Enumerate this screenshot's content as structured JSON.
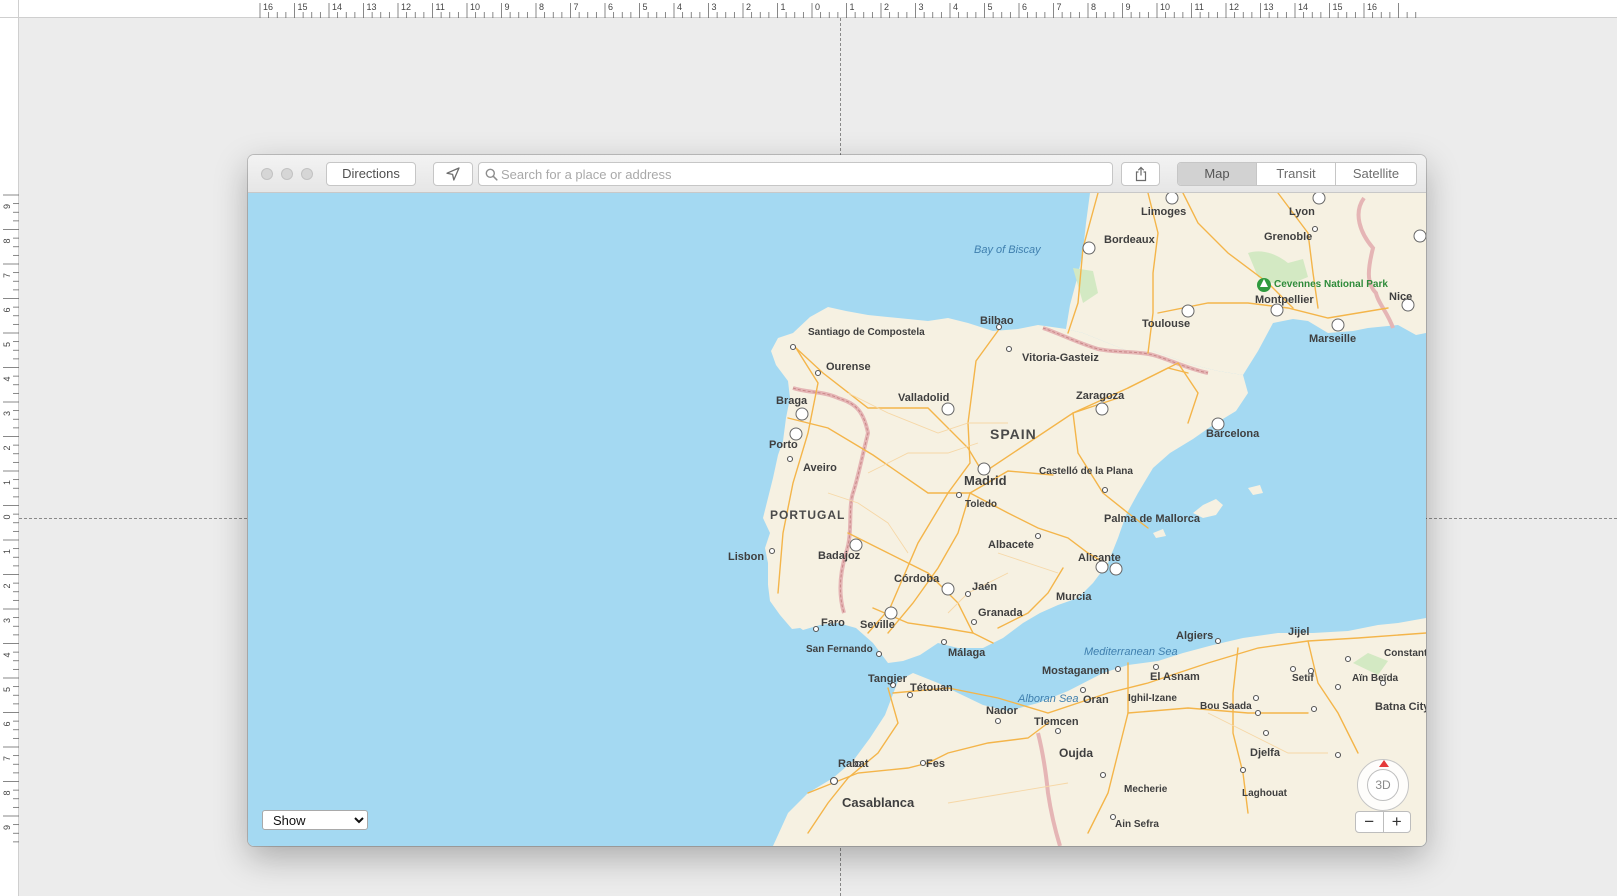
{
  "ruler": {
    "top_labels": [
      "16",
      "15",
      "14",
      "13",
      "12",
      "11",
      "10",
      "9",
      "8",
      "7",
      "6",
      "5",
      "4",
      "3",
      "2",
      "1",
      "0",
      "1",
      "2",
      "3",
      "4",
      "5",
      "6",
      "7",
      "8",
      "9",
      "10",
      "11",
      "12",
      "13",
      "14",
      "15",
      "16"
    ],
    "left_labels": [
      "9",
      "8",
      "7",
      "6",
      "5",
      "4",
      "3",
      "2",
      "1",
      "0",
      "1",
      "2",
      "3",
      "4",
      "5",
      "6",
      "7",
      "8",
      "9"
    ]
  },
  "window": {
    "toolbar": {
      "directions_label": "Directions",
      "location_icon": "location-arrow-icon",
      "search_placeholder": "Search for a place or address",
      "search_value": "",
      "share_icon": "share-icon",
      "view_modes": [
        "Map",
        "Transit",
        "Satellite"
      ],
      "active_view": "Map"
    },
    "map": {
      "water_labels": [
        "Bay of Biscay",
        "Mediterranean Sea",
        "Alboran Sea"
      ],
      "country_labels": [
        "SPAIN",
        "PORTUGAL"
      ],
      "park_label": "Cevennes National Park",
      "cities": [
        "Limoges",
        "Lyon",
        "Bordeaux",
        "Grenoble",
        "Bilbao",
        "Toulouse",
        "Montpellier",
        "Nice",
        "Santiago de Compostela",
        "Vitoria-Gasteiz",
        "Marseille",
        "Ourense",
        "Valladolid",
        "Zaragoza",
        "Braga",
        "Barcelona",
        "Porto",
        "Aveiro",
        "Madrid",
        "Castelló de la Plana",
        "Toledo",
        "Palma de Mallorca",
        "Lisbon",
        "Badajoz",
        "Albacete",
        "Alicante",
        "Córdoba",
        "Jaén",
        "Murcia",
        "Seville",
        "Granada",
        "Faro",
        "San Fernando",
        "Málaga",
        "Algiers",
        "Jijel",
        "Tangier",
        "Tétouan",
        "Mostaganem",
        "El Asnam",
        "Setif",
        "Aïn Beïda",
        "Constantine",
        "Oran",
        "Ighil-Izane",
        "Bou Saada",
        "Batna City",
        "Nador",
        "Tlemcen",
        "Oujda",
        "Djelfa",
        "Rabat",
        "Fes",
        "Mecherie",
        "Laghouat",
        "Casablanca",
        "Ain Sefra"
      ],
      "show_select": {
        "value": "Show",
        "options": [
          "Show"
        ]
      },
      "compass_label": "3D",
      "zoom_out_label": "−",
      "zoom_in_label": "+"
    }
  }
}
